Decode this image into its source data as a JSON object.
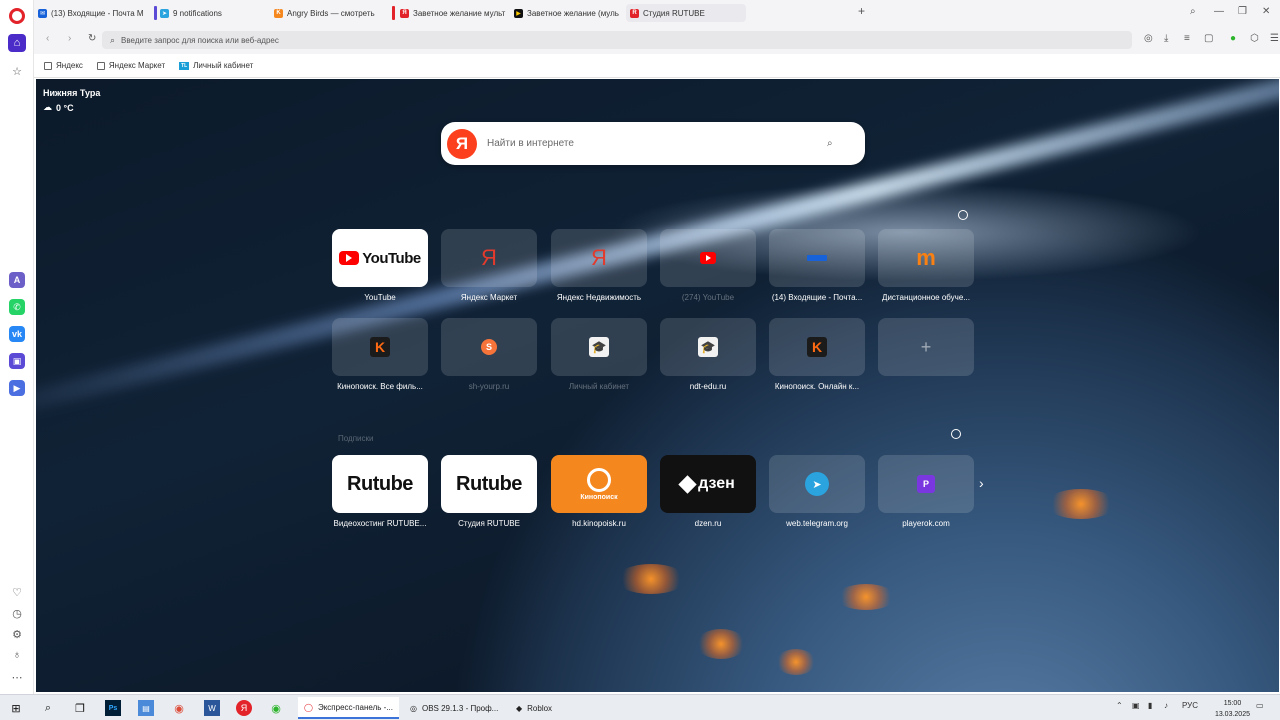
{
  "tabs": [
    {
      "title": "(13) Входящие - Почта М",
      "color": "#1761d9"
    },
    {
      "title": "9 notifications",
      "color": "#2aa3df"
    },
    {
      "title": "Angry Birds — смотреть",
      "color": "#f5871f"
    },
    {
      "title": "Заветное желание мульт",
      "color": "#e3232a"
    },
    {
      "title": "Заветное желание (муль",
      "color": "#111111"
    },
    {
      "title": "Студия RUTUBE",
      "color": "#e3232a"
    }
  ],
  "address_bar": {
    "placeholder": "Введите запрос для поиска или веб-адрес"
  },
  "bookmarks": [
    {
      "label": "Яндекс"
    },
    {
      "label": "Яндекс Маркет"
    },
    {
      "label": "Личный кабинет"
    }
  ],
  "weather": {
    "city": "Нижняя Тура",
    "temp": "0 °C"
  },
  "search": {
    "placeholder": "Найти в интернете",
    "logo": "Я"
  },
  "speed_dial": [
    {
      "label": "YouTube",
      "icon": "youtube-logo",
      "logo_text": "YouTube"
    },
    {
      "label": "Яндекс Маркет",
      "icon": "yandex-icon",
      "logo_text": "Я"
    },
    {
      "label": "Яндекс Недвижимость",
      "icon": "yandex-icon",
      "logo_text": "Я"
    },
    {
      "label": "(274) YouTube",
      "icon": "youtube-icon"
    },
    {
      "label": "(14) Входящие - Почта...",
      "icon": "mail-icon"
    },
    {
      "label": "Дистанционное обуче...",
      "icon": "moodle-icon",
      "logo_text": "m"
    },
    {
      "label": "Кинопоиск. Все филь...",
      "icon": "kinopoisk-icon",
      "logo_text": "K"
    },
    {
      "label": "sh-yourp.ru",
      "icon": "s-icon",
      "logo_text": "S"
    },
    {
      "label": "Личный кабинет",
      "icon": "graduation-icon",
      "logo_text": "🎓"
    },
    {
      "label": "ndt-edu.ru",
      "icon": "graduation-icon",
      "logo_text": "🎓"
    },
    {
      "label": "Кинопоиск. Онлайн к...",
      "icon": "kinopoisk-icon",
      "logo_text": "K"
    },
    {
      "label": "",
      "icon": "plus-icon",
      "logo_text": "+"
    }
  ],
  "subscriptions": {
    "title": "Подписки",
    "items": [
      {
        "label": "Видеохостинг RUTUBE...",
        "logo_text": "Rutube"
      },
      {
        "label": "Студия RUTUBE",
        "logo_text": "Rutube"
      },
      {
        "label": "hd.kinopoisk.ru",
        "logo_text": "Кинопоиск"
      },
      {
        "label": "dzen.ru",
        "logo_text": "дзен"
      },
      {
        "label": "web.telegram.org",
        "logo_text": "➤"
      },
      {
        "label": "playerok.com",
        "logo_text": "P"
      }
    ]
  },
  "taskbar": {
    "apps": [
      {
        "label": "Экспресс-панель -..."
      },
      {
        "label": "OBS 29.1.3 - Проф..."
      },
      {
        "label": "Roblox"
      }
    ],
    "lang": "РУС",
    "time": "15:00",
    "date": "13.03.2025"
  }
}
